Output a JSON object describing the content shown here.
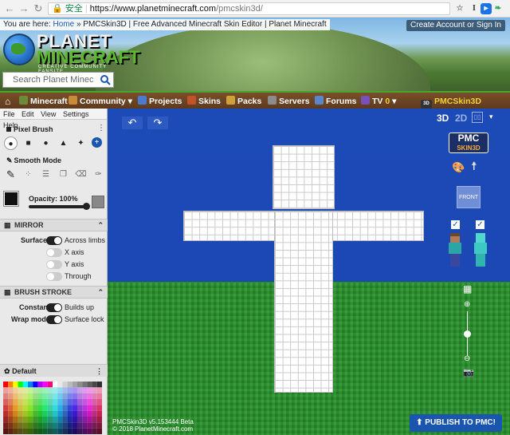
{
  "browser": {
    "security_label": "安全",
    "url_host": "https://www.planetminecraft.com",
    "url_path": "/pmcskin3d/"
  },
  "banner": {
    "breadcrumb_prefix": "You are here:",
    "breadcrumb_home": "Home",
    "breadcrumb_rest": "» PMCSkin3D | Free Advanced Minecraft Skin Editor | Planet Minecraft",
    "create_account": "Create Account",
    "or": "or",
    "sign_in": "Sign In",
    "logo_line1": "PLANET",
    "logo_line2": "MINECRAFT",
    "logo_tagline": "CREATIVE COMMUNITY FANSITE",
    "search_placeholder": "Search Planet Minec"
  },
  "menubar": {
    "items": [
      "Minecraft ▾",
      "Community ▾",
      "Projects",
      "Skins",
      "Packs",
      "Servers",
      "Forums",
      "TV",
      "0",
      "▾",
      "PMCSkin3D"
    ]
  },
  "sidebar": {
    "menu": [
      "File",
      "Edit",
      "View",
      "Settings",
      "Help"
    ],
    "tool_title": "Pixel Brush",
    "smooth_mode": "Smooth Mode",
    "opacity_label": "Opacity: 100%",
    "opacity_value": 1.0,
    "mirror_header": "MIRROR",
    "surface_label": "Surface",
    "across_limbs": "Across limbs",
    "x_axis": "X axis",
    "y_axis": "Y axis",
    "through": "Through",
    "brush_stroke_header": "BRUSH STROKE",
    "constant_label": "Constant",
    "builds_up": "Builds up",
    "wrap_model_label": "Wrap model",
    "surface_lock": "Surface lock",
    "palette_title": "Default"
  },
  "viewport": {
    "view_3d": "3D",
    "view_2d": "2D",
    "brand_top": "PMC",
    "brand_bottom": "SKIN3D",
    "front_label": "FRONT",
    "version_line1": "PMCSkin3D v5.153444 Beta",
    "version_line2": "© 2018 PlanetMinecraft.com",
    "publish_label": "PUBLISH TO PMC!"
  },
  "colors": {
    "sky": "#1b48b5",
    "grass": "#27922a",
    "menubar": "#6a4424",
    "accent": "#1a56b0"
  }
}
